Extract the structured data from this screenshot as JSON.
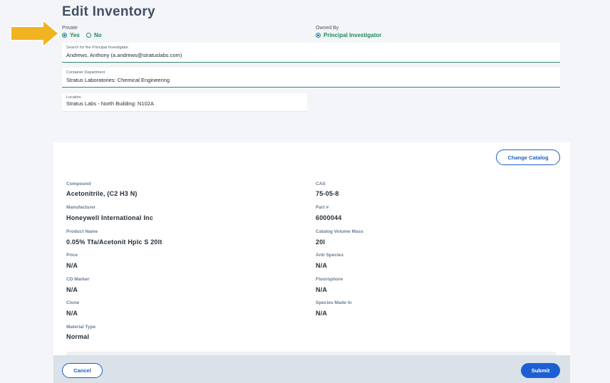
{
  "page": {
    "title": "Edit Inventory"
  },
  "private": {
    "label": "Private",
    "yes_label": "Yes",
    "no_label": "No",
    "selected": "Yes"
  },
  "owned_by": {
    "label": "Owned By",
    "option_label": "Principal Investigator"
  },
  "fields": {
    "pi": {
      "label": "Search for the Principal Investigator",
      "value": "Andrews, Anthony (a.andrews@stratuslabs.com)"
    },
    "department": {
      "label": "Container Department",
      "value": "Stratus Laboratories:  Chemical Engineering"
    },
    "location": {
      "label": "Location",
      "value": "Stratus Labs - North Building: N102A"
    }
  },
  "catalog": {
    "change_label": "Change Catalog",
    "details": [
      {
        "label": "Compound",
        "value": "Acetonitrile, (C2 H3 N)"
      },
      {
        "label": "CAS",
        "value": "75-05-8"
      },
      {
        "label": "Manufacturer",
        "value": "Honeywell International Inc"
      },
      {
        "label": "Part #",
        "value": "6000044"
      },
      {
        "label": "Product Name",
        "value": "0.05% Tfa/Acetonit Hplc S 20lt"
      },
      {
        "label": "Catalog Volume Mass",
        "value": "20l"
      },
      {
        "label": "Price",
        "value": "N/A"
      },
      {
        "label": "Anti Species",
        "value": "N/A"
      },
      {
        "label": "CD Marker",
        "value": "N/A"
      },
      {
        "label": "Fluorophore",
        "value": "N/A"
      },
      {
        "label": "Clone",
        "value": "N/A"
      },
      {
        "label": "Species Made In",
        "value": "N/A"
      },
      {
        "label": "Material Type",
        "value": "Normal"
      }
    ]
  },
  "footer": {
    "cancel_label": "Cancel",
    "submit_label": "Submit"
  },
  "colors": {
    "accent_green": "#1e8a5a",
    "primary_blue": "#1d5fd3",
    "arrow": "#f2b321"
  },
  "icons": {
    "arrow": "pointer-arrow-icon",
    "radio": "radio-icon"
  }
}
